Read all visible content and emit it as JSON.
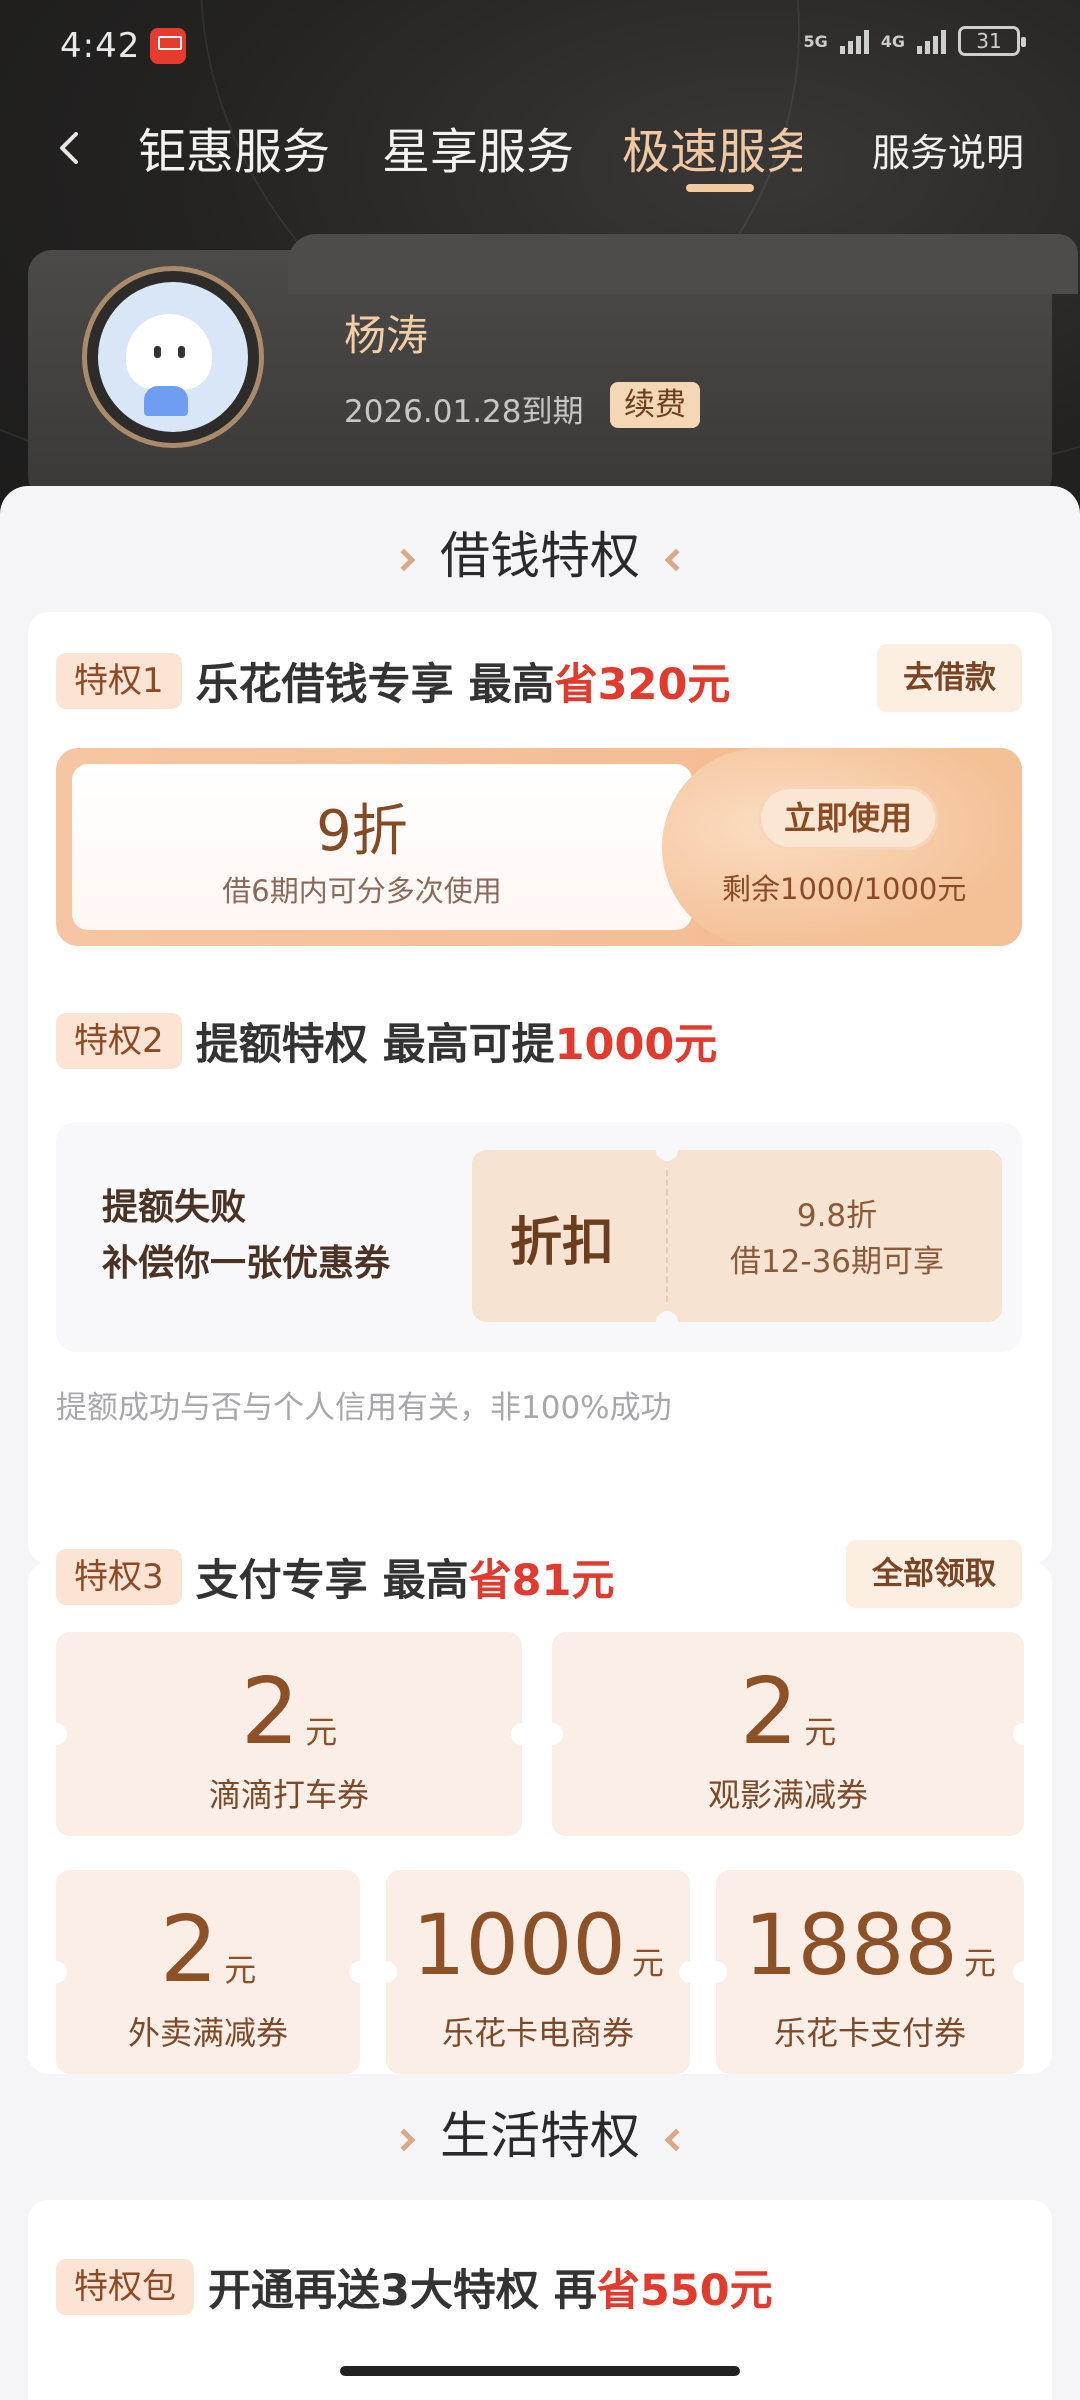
{
  "status_bar": {
    "time": "4:42",
    "net1": "5G",
    "net2": "4G",
    "battery": "31"
  },
  "nav": {
    "tabs": [
      {
        "label": "钜惠服务"
      },
      {
        "label": "星享服务"
      },
      {
        "label": "极速服务"
      }
    ],
    "active_tab": "极速服务",
    "service_desc": "服务说明"
  },
  "user": {
    "name": "杨涛",
    "expiry": "2026.01.28到期",
    "renew_label": "续费"
  },
  "sections": {
    "borrow_title": "借钱特权",
    "life_title": "生活特权"
  },
  "priv1": {
    "tag": "特权1",
    "title_prefix": "乐花借钱专享 最高",
    "title_hl": "省320元",
    "action": "去借款",
    "coupon": {
      "discount": "9折",
      "desc": "借6期内可分多次使用",
      "use_label": "立即使用",
      "remain": "剩余1000/1000元"
    }
  },
  "priv2": {
    "tag": "特权2",
    "title_prefix": "提额特权 最高可提",
    "title_hl": "1000元",
    "fail_line1": "提额失败",
    "fail_line2": "补偿你一张优惠券",
    "ticket": {
      "kind": "折扣",
      "line1": "9.8折",
      "line2": "借12-36期可享"
    },
    "note": "提额成功与否与个人信用有关，非100%成功"
  },
  "priv3": {
    "tag": "特权3",
    "title_prefix": "支付专享 最高",
    "title_hl": "省81元",
    "action": "全部领取",
    "vouchers": [
      {
        "amount": "2",
        "unit": "元",
        "label": "滴滴打车券"
      },
      {
        "amount": "2",
        "unit": "元",
        "label": "观影满减券"
      },
      {
        "amount": "2",
        "unit": "元",
        "label": "外卖满减券"
      },
      {
        "amount": "1000",
        "unit": "元",
        "label": "乐花卡电商券"
      },
      {
        "amount": "1888",
        "unit": "元",
        "label": "乐花卡支付券"
      }
    ]
  },
  "pack": {
    "tag": "特权包",
    "title_prefix": "开通再送3大特权 再",
    "title_hl": "省550元"
  },
  "colors": {
    "accent_red": "#e23a2d",
    "gold": "#f0c9a3",
    "tag_bg": "#fde3d4"
  }
}
